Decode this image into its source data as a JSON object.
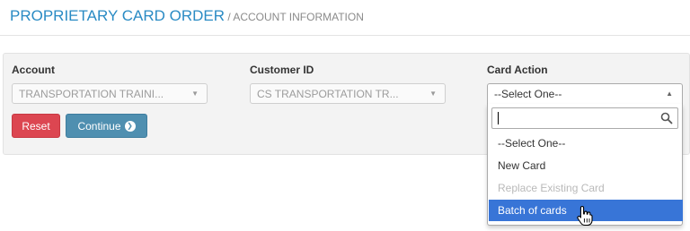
{
  "header": {
    "title": "PROPRIETARY CARD ORDER",
    "subtitle": " / ACCOUNT INFORMATION"
  },
  "form": {
    "account": {
      "label": "Account",
      "value": "TRANSPORTATION TRAINI..."
    },
    "customer_id": {
      "label": "Customer ID",
      "value": "CS TRANSPORTATION TR..."
    },
    "card_action": {
      "label": "Card Action",
      "value": "--Select One--",
      "options": [
        {
          "label": "--Select One--",
          "disabled": false,
          "highlighted": false
        },
        {
          "label": "New Card",
          "disabled": false,
          "highlighted": false
        },
        {
          "label": "Replace Existing Card",
          "disabled": true,
          "highlighted": false
        },
        {
          "label": "Batch of cards",
          "disabled": false,
          "highlighted": true
        }
      ],
      "search_value": ""
    }
  },
  "buttons": {
    "reset_label": "Reset",
    "continue_label": "Continue"
  },
  "icons": {
    "caret_down": "dropdown-caret-icon",
    "caret_up": "dropdown-caret-up-icon",
    "search": "search-icon",
    "continue_arrow": "arrow-circle-icon",
    "pointer": "hand-pointer-icon"
  },
  "colors": {
    "title": "#2a8bc4",
    "reset": "#dc4651",
    "continue": "#4f8fb0",
    "highlight": "#3875d7"
  }
}
